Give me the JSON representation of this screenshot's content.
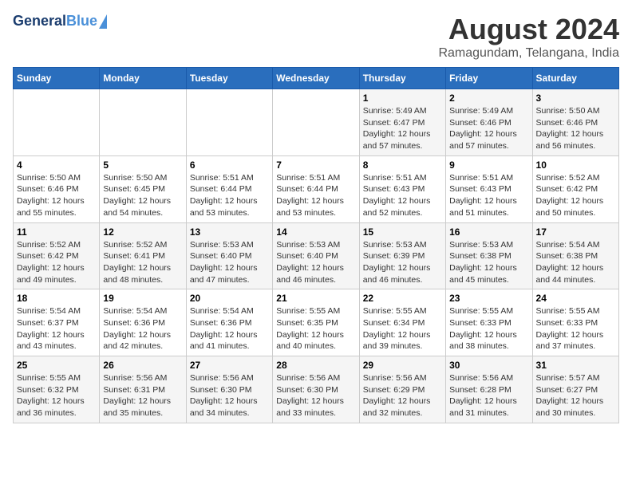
{
  "logo": {
    "general": "General",
    "blue": "Blue"
  },
  "title": "August 2024",
  "subtitle": "Ramagundam, Telangana, India",
  "weekdays": [
    "Sunday",
    "Monday",
    "Tuesday",
    "Wednesday",
    "Thursday",
    "Friday",
    "Saturday"
  ],
  "weeks": [
    [
      {
        "day": "",
        "info": ""
      },
      {
        "day": "",
        "info": ""
      },
      {
        "day": "",
        "info": ""
      },
      {
        "day": "",
        "info": ""
      },
      {
        "day": "1",
        "info": "Sunrise: 5:49 AM\nSunset: 6:47 PM\nDaylight: 12 hours\nand 57 minutes."
      },
      {
        "day": "2",
        "info": "Sunrise: 5:49 AM\nSunset: 6:46 PM\nDaylight: 12 hours\nand 57 minutes."
      },
      {
        "day": "3",
        "info": "Sunrise: 5:50 AM\nSunset: 6:46 PM\nDaylight: 12 hours\nand 56 minutes."
      }
    ],
    [
      {
        "day": "4",
        "info": "Sunrise: 5:50 AM\nSunset: 6:46 PM\nDaylight: 12 hours\nand 55 minutes."
      },
      {
        "day": "5",
        "info": "Sunrise: 5:50 AM\nSunset: 6:45 PM\nDaylight: 12 hours\nand 54 minutes."
      },
      {
        "day": "6",
        "info": "Sunrise: 5:51 AM\nSunset: 6:44 PM\nDaylight: 12 hours\nand 53 minutes."
      },
      {
        "day": "7",
        "info": "Sunrise: 5:51 AM\nSunset: 6:44 PM\nDaylight: 12 hours\nand 53 minutes."
      },
      {
        "day": "8",
        "info": "Sunrise: 5:51 AM\nSunset: 6:43 PM\nDaylight: 12 hours\nand 52 minutes."
      },
      {
        "day": "9",
        "info": "Sunrise: 5:51 AM\nSunset: 6:43 PM\nDaylight: 12 hours\nand 51 minutes."
      },
      {
        "day": "10",
        "info": "Sunrise: 5:52 AM\nSunset: 6:42 PM\nDaylight: 12 hours\nand 50 minutes."
      }
    ],
    [
      {
        "day": "11",
        "info": "Sunrise: 5:52 AM\nSunset: 6:42 PM\nDaylight: 12 hours\nand 49 minutes."
      },
      {
        "day": "12",
        "info": "Sunrise: 5:52 AM\nSunset: 6:41 PM\nDaylight: 12 hours\nand 48 minutes."
      },
      {
        "day": "13",
        "info": "Sunrise: 5:53 AM\nSunset: 6:40 PM\nDaylight: 12 hours\nand 47 minutes."
      },
      {
        "day": "14",
        "info": "Sunrise: 5:53 AM\nSunset: 6:40 PM\nDaylight: 12 hours\nand 46 minutes."
      },
      {
        "day": "15",
        "info": "Sunrise: 5:53 AM\nSunset: 6:39 PM\nDaylight: 12 hours\nand 46 minutes."
      },
      {
        "day": "16",
        "info": "Sunrise: 5:53 AM\nSunset: 6:38 PM\nDaylight: 12 hours\nand 45 minutes."
      },
      {
        "day": "17",
        "info": "Sunrise: 5:54 AM\nSunset: 6:38 PM\nDaylight: 12 hours\nand 44 minutes."
      }
    ],
    [
      {
        "day": "18",
        "info": "Sunrise: 5:54 AM\nSunset: 6:37 PM\nDaylight: 12 hours\nand 43 minutes."
      },
      {
        "day": "19",
        "info": "Sunrise: 5:54 AM\nSunset: 6:36 PM\nDaylight: 12 hours\nand 42 minutes."
      },
      {
        "day": "20",
        "info": "Sunrise: 5:54 AM\nSunset: 6:36 PM\nDaylight: 12 hours\nand 41 minutes."
      },
      {
        "day": "21",
        "info": "Sunrise: 5:55 AM\nSunset: 6:35 PM\nDaylight: 12 hours\nand 40 minutes."
      },
      {
        "day": "22",
        "info": "Sunrise: 5:55 AM\nSunset: 6:34 PM\nDaylight: 12 hours\nand 39 minutes."
      },
      {
        "day": "23",
        "info": "Sunrise: 5:55 AM\nSunset: 6:33 PM\nDaylight: 12 hours\nand 38 minutes."
      },
      {
        "day": "24",
        "info": "Sunrise: 5:55 AM\nSunset: 6:33 PM\nDaylight: 12 hours\nand 37 minutes."
      }
    ],
    [
      {
        "day": "25",
        "info": "Sunrise: 5:55 AM\nSunset: 6:32 PM\nDaylight: 12 hours\nand 36 minutes."
      },
      {
        "day": "26",
        "info": "Sunrise: 5:56 AM\nSunset: 6:31 PM\nDaylight: 12 hours\nand 35 minutes."
      },
      {
        "day": "27",
        "info": "Sunrise: 5:56 AM\nSunset: 6:30 PM\nDaylight: 12 hours\nand 34 minutes."
      },
      {
        "day": "28",
        "info": "Sunrise: 5:56 AM\nSunset: 6:30 PM\nDaylight: 12 hours\nand 33 minutes."
      },
      {
        "day": "29",
        "info": "Sunrise: 5:56 AM\nSunset: 6:29 PM\nDaylight: 12 hours\nand 32 minutes."
      },
      {
        "day": "30",
        "info": "Sunrise: 5:56 AM\nSunset: 6:28 PM\nDaylight: 12 hours\nand 31 minutes."
      },
      {
        "day": "31",
        "info": "Sunrise: 5:57 AM\nSunset: 6:27 PM\nDaylight: 12 hours\nand 30 minutes."
      }
    ]
  ]
}
